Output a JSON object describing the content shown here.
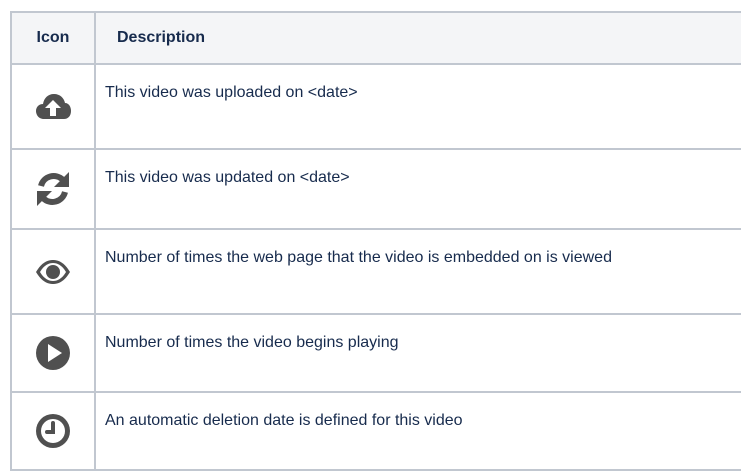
{
  "table": {
    "headers": {
      "icon": "Icon",
      "description": "Description"
    },
    "rows": [
      {
        "icon": "cloud-upload-icon",
        "description": "This video was uploaded on <date>"
      },
      {
        "icon": "refresh-icon",
        "description": "This video was updated on <date>"
      },
      {
        "icon": "eye-icon",
        "description": "Number of times the web page that the video is embedded on is viewed"
      },
      {
        "icon": "play-circle-icon",
        "description": "Number of times the video begins playing"
      },
      {
        "icon": "clock-icon",
        "description": "An automatic deletion date is defined for this video"
      }
    ]
  },
  "colors": {
    "icon": "#505050",
    "border": "#c1c7d0",
    "header_bg": "#f4f5f7",
    "text": "#172b4d"
  }
}
